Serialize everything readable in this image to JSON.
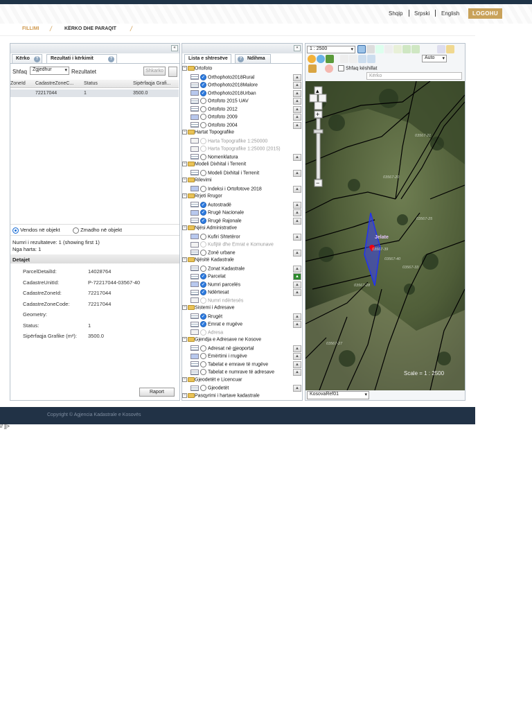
{
  "header": {
    "lang": [
      "Shqip",
      "Srpski",
      "English"
    ],
    "logout": "LOGOHU"
  },
  "breadcrumb": {
    "home": "FILLIMI",
    "current": "KËRKO DHE PARAQIT"
  },
  "left": {
    "tabs": [
      "Kërko",
      "Rezultati i kërkimit"
    ],
    "show_label": "Shfaq",
    "show_value": "Zgjedhur",
    "results_label": "Rezultatet",
    "clear_btn": "Shkarko",
    "columns": [
      "ZoneId",
      "CadastreZoneC...",
      "Status",
      "Sipërfaqja Grafi..."
    ],
    "row": [
      "",
      "72217044",
      "1",
      "3500.0"
    ],
    "radio1": "Vendos në objekt",
    "radio2": "Zmadho në objekt",
    "count": "Numri i rezultateve: 1 (showing first 1)",
    "count2": "Nga harta: 1",
    "details_title": "Detajet",
    "details": [
      [
        "ParcelDetailId:",
        "14028764"
      ],
      [
        "CadastreUnitId:",
        "P-72217044-03567-40"
      ],
      [
        "CadastreZoneId:",
        "72217044"
      ],
      [
        "CadastreZoneCode:",
        "72217044"
      ],
      [
        "Geometry:",
        ""
      ],
      [
        "Status:",
        "1"
      ],
      [
        "Sipërfaqja Grafike (m²):",
        "3500.0"
      ]
    ],
    "report_btn": "Raport"
  },
  "middle": {
    "tabs": [
      "Lista e shtresëve",
      "Ndihma"
    ],
    "tree": [
      [
        "g",
        "Ortofoto",
        0
      ],
      [
        "c",
        "Orthophoto2018Rural",
        1
      ],
      [
        "c",
        "Orthophoto2018Malore",
        1
      ],
      [
        "c",
        "Orthophoto2018Urban",
        1
      ],
      [
        "u",
        "Ortofoto 2015 UAV",
        1
      ],
      [
        "u",
        "Ortofoto 2012",
        1
      ],
      [
        "u",
        "Ortofoto 2009",
        1
      ],
      [
        "u",
        "Ortofoto 2004",
        1
      ],
      [
        "g",
        "Hartat Topografike",
        0
      ],
      [
        "d",
        "Harta Topografike 1:250000",
        1
      ],
      [
        "d",
        "Harta Topografike 1:25000 (2015)",
        1
      ],
      [
        "u",
        "Nomenklatura",
        1
      ],
      [
        "g",
        "Modeli Dixhital i Terrenit",
        0
      ],
      [
        "u",
        "Modeli Dixhital i Terrenit",
        1
      ],
      [
        "g",
        "Rilevimi",
        0
      ],
      [
        "u",
        "Indeksi i Ortofotove 2018",
        1
      ],
      [
        "g",
        "Rrjeti Rrugor",
        0
      ],
      [
        "c",
        "Autostradë",
        1
      ],
      [
        "c",
        "Rrugë Nacionale",
        1
      ],
      [
        "c",
        "Rrugë Rajonale",
        1
      ],
      [
        "g",
        "Njësi Administrative",
        0
      ],
      [
        "u",
        "Kufiri Shtetëror",
        1
      ],
      [
        "d",
        "Kufijtë dhe Emrat e Komunave",
        1
      ],
      [
        "u",
        "Zonë urbane",
        1
      ],
      [
        "g",
        "Njësitë Kadastrale",
        0
      ],
      [
        "u",
        "Zonat Kadastrale",
        1
      ],
      [
        "c",
        "Parcelat",
        1
      ],
      [
        "c",
        "Numri parcelës",
        1
      ],
      [
        "c",
        "Ndërtesat",
        1
      ],
      [
        "d",
        "Numri ndërtesës",
        1
      ],
      [
        "g",
        "Sistemi i Adresave",
        0
      ],
      [
        "c",
        "Rrugët",
        1
      ],
      [
        "c",
        "Emrat e rrugëve",
        1
      ],
      [
        "d",
        "Adresa",
        1
      ],
      [
        "g",
        "Gjendja e Adresave ne Kosove",
        0
      ],
      [
        "u",
        "Adresat në gjeoportal",
        1
      ],
      [
        "u",
        "Emërtimi i rrugëve",
        1
      ],
      [
        "u",
        "Tabelat e emrave të rrugëve",
        1
      ],
      [
        "u",
        "Tabelat e numrave të adresave",
        1
      ],
      [
        "g",
        "Gjeodetët e Licencuar",
        0
      ],
      [
        "u",
        "Gjeodetët",
        1
      ],
      [
        "g",
        "Pasqyrimi i hartave kadastrale",
        0
      ]
    ]
  },
  "map": {
    "scale_select": "1 : 2500",
    "auto": "Auto",
    "checkbox_label": "Shfaq këshillat",
    "search": "Kërko",
    "scale_text": "Scale = 1 : 2500",
    "baselayer": "KosovaRef01",
    "place": "Jelate",
    "parcels": [
      "03567-21",
      "03567-20",
      "03567-25",
      "03567-39",
      "03567-40",
      "03567-33",
      "03567-28",
      "03567-27"
    ]
  },
  "footer": {
    "copyright": "Copyright © Agjencia Kadastrale e Kosovës"
  },
  "extra": {
    "bottom_text": "// ]]>"
  },
  "colors": {
    "accent": "#c9a25a",
    "footer": "#213246",
    "parcel": "#2233ee"
  }
}
